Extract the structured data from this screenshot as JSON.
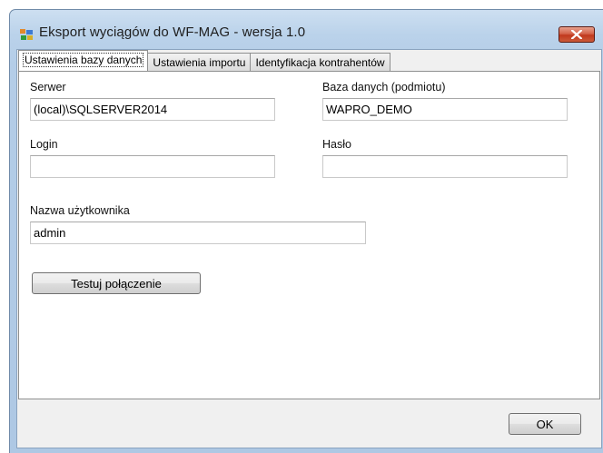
{
  "window": {
    "title": "Eksport wyciągów do WF-MAG - wersja 1.0"
  },
  "tabs": [
    {
      "label": "Ustawienia bazy danych",
      "active": true
    },
    {
      "label": "Ustawienia importu",
      "active": false
    },
    {
      "label": "Identyfikacja kontrahentów",
      "active": false
    }
  ],
  "form": {
    "server_label": "Serwer",
    "server_value": "(local)\\SQLSERVER2014",
    "database_label": "Baza danych (podmiotu)",
    "database_value": "WAPRO_DEMO",
    "login_label": "Login",
    "login_value": "",
    "password_label": "Hasło",
    "password_value": "",
    "username_label": "Nazwa użytkownika",
    "username_value": "admin",
    "test_button_label": "Testuj połączenie"
  },
  "footer": {
    "ok_label": "OK"
  },
  "icons": {
    "app_icon": "app-windows-icon",
    "close_icon": "close-icon"
  },
  "colors": {
    "close_button": "#c7442a",
    "title_bar": "#bad2ea"
  }
}
